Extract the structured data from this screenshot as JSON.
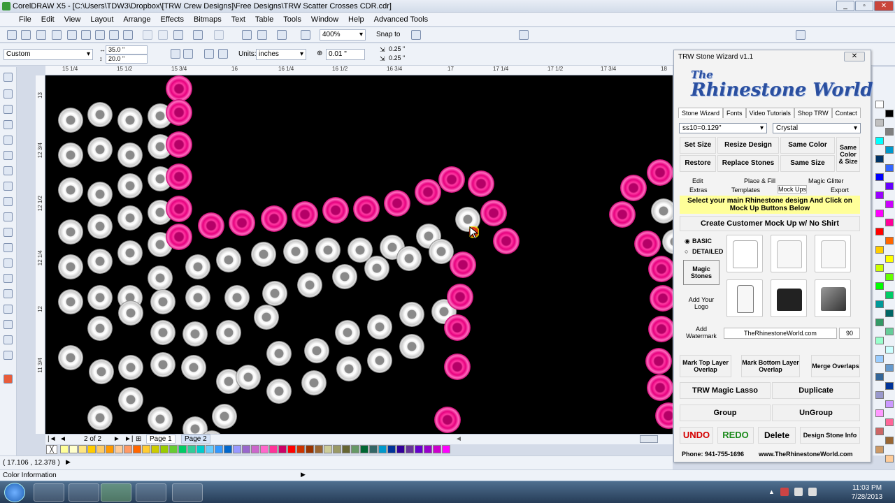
{
  "window": {
    "title": "CorelDRAW X5 - [C:\\Users\\TDW3\\Dropbox\\[TRW Crew Designs]\\Free Designs\\TRW Scatter Crosses CDR.cdr]"
  },
  "menu": [
    "File",
    "Edit",
    "View",
    "Layout",
    "Arrange",
    "Effects",
    "Bitmaps",
    "Text",
    "Table",
    "Tools",
    "Window",
    "Help",
    "Advanced Tools"
  ],
  "standard_toolbar": {
    "zoom": "400%",
    "snap_to": "Snap to"
  },
  "property_bar": {
    "preset": "Custom",
    "width": "35.0 \"",
    "height": "20.0 \"",
    "units_label": "Units:",
    "units": "inches",
    "nudge": "0.01 \"",
    "dup_x": "0.25 \"",
    "dup_y": "0.25 \""
  },
  "ruler_top": [
    "15 1/4",
    "15 1/2",
    "15 3/4",
    "16",
    "16 1/4",
    "16 1/2",
    "16 3/4",
    "17",
    "17 1/4",
    "17 1/2",
    "17 3/4",
    "18"
  ],
  "ruler_left": [
    "13",
    "12 3/4",
    "12 1/2",
    "12 1/4",
    "12",
    "11 3/4"
  ],
  "pages": {
    "counter": "2 of 2",
    "page1": "Page 1",
    "page2": "Page 2"
  },
  "status": {
    "coords": "( 17.106 , 12.378 )",
    "info": "Color Information"
  },
  "clock": {
    "time": "11:03 PM",
    "date": "7/28/2013"
  },
  "wizard": {
    "title": "TRW Stone Wizard v1.1",
    "logo_top": "The",
    "logo_main": "Rhinestone World",
    "nav_tabs": [
      "Stone Wizard",
      "Fonts",
      "Video Tutorials",
      "Shop TRW",
      "Contact"
    ],
    "size_select": "ss10=0.129\"",
    "color_select": "Crystal",
    "buttons": {
      "set_size": "Set Size",
      "resize": "Resize Design",
      "same_color": "Same Color",
      "same_color_size": "Same Color & Size",
      "restore": "Restore",
      "replace": "Replace Stones",
      "same_size": "Same Size"
    },
    "subtabs_row1": [
      "Edit",
      "Place & Fill",
      "Magic Glitter"
    ],
    "subtabs_row2": [
      "Extras",
      "Templates",
      "Mock Ups",
      "Export"
    ],
    "notice": "Select your main Rhinestone design And Click on Mock Up Buttons Below",
    "mockup_button": "Create Customer Mock Up w/ No Shirt",
    "radio_basic": "BASIC",
    "radio_detailed": "DETAILED",
    "magic_stones": "Magic Stones",
    "add_logo": "Add Your Logo",
    "add_watermark": "Add Watermark",
    "watermark_text": "TheRhinestoneWorld.com",
    "watermark_value": "90",
    "mark_top": "Mark Top Layer Overlap",
    "mark_bottom": "Mark Bottom Layer Overlap",
    "merge": "Merge Overlaps",
    "lasso": "TRW Magic Lasso",
    "duplicate": "Duplicate",
    "group": "Group",
    "ungroup": "UnGroup",
    "undo": "UNDO",
    "redo": "REDO",
    "delete": "Delete",
    "design_info": "Design Stone Info",
    "phone": "Phone: 941-755-1696",
    "website": "www.TheRhinestoneWorld.com"
  },
  "colors": {
    "canvas": "#000000",
    "crystal": "#ffffff",
    "fuchsia": "#e6007e",
    "undo": "#d40000",
    "redo": "#1a8a1a"
  }
}
